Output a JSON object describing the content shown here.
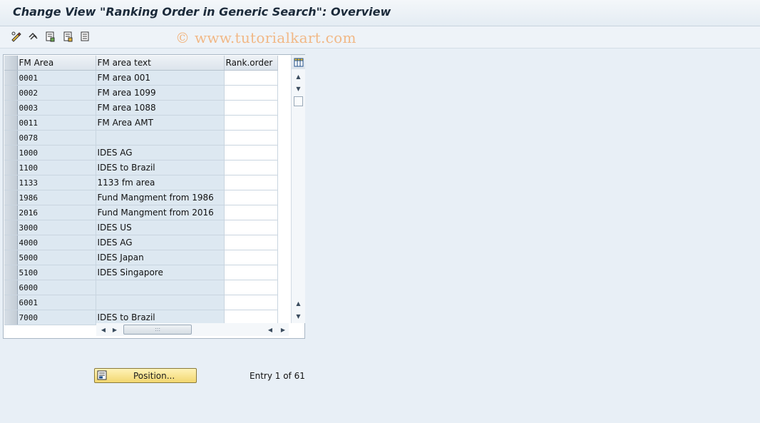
{
  "window": {
    "title": "Change View \"Ranking Order in Generic Search\": Overview"
  },
  "toolbar": {
    "watermark": "© www.tutorialkart.com",
    "icons": [
      "edit-display-icon",
      "undo-icon",
      "copy-entry-icon",
      "save-entry-icon",
      "paste-entry-icon"
    ]
  },
  "table": {
    "columns": [
      "FM Area",
      "FM area text",
      "Rank.order"
    ],
    "rows": [
      {
        "area": "0001",
        "text": "FM area 001",
        "rank": ""
      },
      {
        "area": "0002",
        "text": "FM area 1099",
        "rank": ""
      },
      {
        "area": "0003",
        "text": "FM area 1088",
        "rank": ""
      },
      {
        "area": "0011",
        "text": "FM Area AMT",
        "rank": ""
      },
      {
        "area": "0078",
        "text": "",
        "rank": ""
      },
      {
        "area": "1000",
        "text": "IDES AG",
        "rank": ""
      },
      {
        "area": "1100",
        "text": "IDES to Brazil",
        "rank": ""
      },
      {
        "area": "1133",
        "text": "1133 fm area",
        "rank": ""
      },
      {
        "area": "1986",
        "text": "Fund Mangment from 1986",
        "rank": ""
      },
      {
        "area": "2016",
        "text": "Fund Mangment from 2016",
        "rank": ""
      },
      {
        "area": "3000",
        "text": "IDES US",
        "rank": ""
      },
      {
        "area": "4000",
        "text": "IDES AG",
        "rank": ""
      },
      {
        "area": "5000",
        "text": "IDES Japan",
        "rank": ""
      },
      {
        "area": "5100",
        "text": "IDES Singapore",
        "rank": ""
      },
      {
        "area": "6000",
        "text": "",
        "rank": ""
      },
      {
        "area": "6001",
        "text": "",
        "rank": ""
      },
      {
        "area": "7000",
        "text": "IDES to Brazil",
        "rank": ""
      }
    ]
  },
  "footer": {
    "position_label": "Position...",
    "entry_info": "Entry 1 of 61"
  },
  "colors": {
    "key_column_bg": "#dde8f1",
    "background": "#e8eff6",
    "button_yellow": "#f2d770"
  }
}
